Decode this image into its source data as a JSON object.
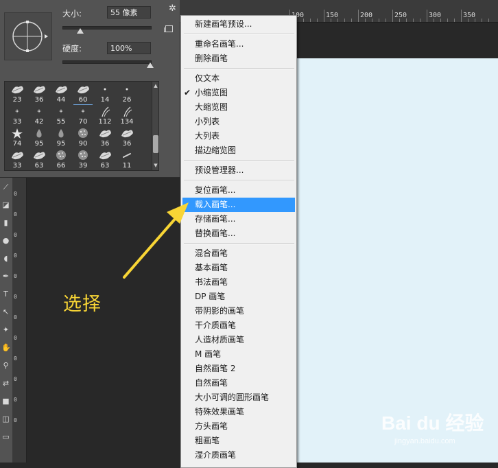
{
  "brush_panel": {
    "size_label": "大小:",
    "size_value": "55 像素",
    "size_level": 0.2,
    "hardness_label": "硬度:",
    "hardness_value": "100%",
    "hardness_level": 1.0,
    "brushes": [
      {
        "size": "23",
        "kind": "leaf"
      },
      {
        "size": "36",
        "kind": "leaf"
      },
      {
        "size": "44",
        "kind": "leaf"
      },
      {
        "size": "60",
        "kind": "leaf",
        "selected": true
      },
      {
        "size": "14",
        "kind": "dot"
      },
      {
        "size": "26",
        "kind": "dot"
      },
      {
        "size": "33",
        "kind": "star-small"
      },
      {
        "size": "42",
        "kind": "star-small"
      },
      {
        "size": "55",
        "kind": "star-small"
      },
      {
        "size": "70",
        "kind": "star-small"
      },
      {
        "size": "112",
        "kind": "grass"
      },
      {
        "size": "134",
        "kind": "grass"
      },
      {
        "size": "74",
        "kind": "star"
      },
      {
        "size": "95",
        "kind": "drop"
      },
      {
        "size": "95",
        "kind": "drop"
      },
      {
        "size": "90",
        "kind": "texture"
      },
      {
        "size": "36",
        "kind": "leaf"
      },
      {
        "size": "36",
        "kind": "leaf"
      },
      {
        "size": "33",
        "kind": "leaf"
      },
      {
        "size": "63",
        "kind": "leaf"
      },
      {
        "size": "66",
        "kind": "texture"
      },
      {
        "size": "39",
        "kind": "texture"
      },
      {
        "size": "63",
        "kind": "leaf"
      },
      {
        "size": "11",
        "kind": "stroke"
      }
    ]
  },
  "menu": {
    "items": [
      {
        "label": "新建画笔预设..."
      },
      {
        "sep": true
      },
      {
        "label": "重命名画笔..."
      },
      {
        "label": "删除画笔"
      },
      {
        "sep": true
      },
      {
        "label": "仅文本"
      },
      {
        "label": "小缩览图",
        "checked": true
      },
      {
        "label": "大缩览图"
      },
      {
        "label": "小列表"
      },
      {
        "label": "大列表"
      },
      {
        "label": "描边缩览图"
      },
      {
        "sep": true
      },
      {
        "label": "预设管理器..."
      },
      {
        "sep": true
      },
      {
        "label": "复位画笔..."
      },
      {
        "label": "载入画笔...",
        "highlighted": true
      },
      {
        "label": "存储画笔..."
      },
      {
        "label": "替换画笔..."
      },
      {
        "sep": true
      },
      {
        "label": "混合画笔"
      },
      {
        "label": "基本画笔"
      },
      {
        "label": "书法画笔"
      },
      {
        "label": "DP 画笔"
      },
      {
        "label": "带阴影的画笔"
      },
      {
        "label": "干介质画笔"
      },
      {
        "label": "人造材质画笔"
      },
      {
        "label": "M 画笔"
      },
      {
        "label": "自然画笔 2"
      },
      {
        "label": "自然画笔"
      },
      {
        "label": "大小可调的圆形画笔"
      },
      {
        "label": "特殊效果画笔"
      },
      {
        "label": "方头画笔"
      },
      {
        "label": "粗画笔"
      },
      {
        "label": "湿介质画笔"
      }
    ]
  },
  "ruler": {
    "ticks": [
      "100",
      "150",
      "200",
      "250",
      "300",
      "350"
    ]
  },
  "annotation": {
    "label": "选择",
    "color": "#f8d535"
  },
  "watermark": {
    "brand": "Bai du 经验",
    "url": "jingyan.baidu.com"
  },
  "colors": {
    "menu_highlight": "#3298fe",
    "canvas": "#e2f2f9",
    "panel": "#535353"
  }
}
